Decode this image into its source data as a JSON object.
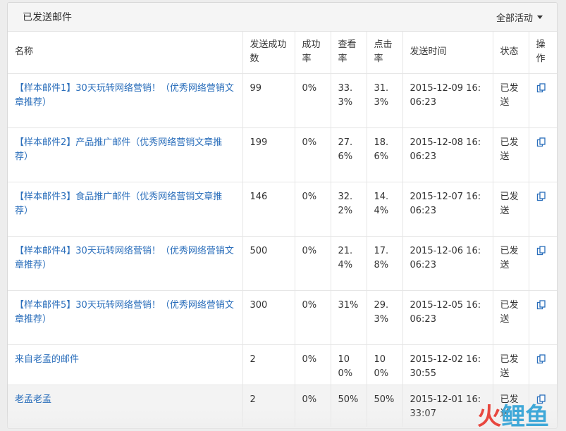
{
  "header": {
    "title": "已发送邮件",
    "activity_filter": "全部活动"
  },
  "columns": {
    "name": "名称",
    "sent": "发送成功数",
    "success_rate": "成功率",
    "view_rate": "查看率",
    "click_rate": "点击率",
    "send_time": "发送时间",
    "status": "状态",
    "action": "操作"
  },
  "rows": [
    {
      "name": "【样本邮件1】30天玩转网络营销！（优秀网络营销文章推荐）",
      "sent": "99",
      "success_rate": "0%",
      "view_rate": "33.3%",
      "click_rate": "31.3%",
      "send_time": "2015-12-09 16:06:23",
      "status": "已发送"
    },
    {
      "name": "【样本邮件2】产品推广邮件（优秀网络营销文章推荐）",
      "sent": "199",
      "success_rate": "0%",
      "view_rate": "27.6%",
      "click_rate": "18.6%",
      "send_time": "2015-12-08 16:06:23",
      "status": "已发送"
    },
    {
      "name": "【样本邮件3】食品推广邮件（优秀网络营销文章推荐）",
      "sent": "146",
      "success_rate": "0%",
      "view_rate": "32.2%",
      "click_rate": "14.4%",
      "send_time": "2015-12-07 16:06:23",
      "status": "已发送"
    },
    {
      "name": "【样本邮件4】30天玩转网络营销！（优秀网络营销文章推荐）",
      "sent": "500",
      "success_rate": "0%",
      "view_rate": "21.4%",
      "click_rate": "17.8%",
      "send_time": "2015-12-06 16:06:23",
      "status": "已发送"
    },
    {
      "name": "【样本邮件5】30天玩转网络营销！（优秀网络营销文章推荐）",
      "sent": "300",
      "success_rate": "0%",
      "view_rate": "31%",
      "click_rate": "29.3%",
      "send_time": "2015-12-05 16:06:23",
      "status": "已发送"
    },
    {
      "name": "来自老孟的邮件",
      "sent": "2",
      "success_rate": "0%",
      "view_rate": "100%",
      "click_rate": "100%",
      "send_time": "2015-12-02 16:30:55",
      "status": "已发送"
    },
    {
      "name": "老孟老孟",
      "sent": "2",
      "success_rate": "0%",
      "view_rate": "50%",
      "click_rate": "50%",
      "send_time": "2015-12-01 16:33:07",
      "status": "已发送"
    }
  ],
  "icons": {
    "copy": "copy-icon",
    "dropdown": "caret-down-icon"
  },
  "watermark": {
    "first": "火",
    "rest": "鲤鱼"
  },
  "colors": {
    "link": "#2a6ebb",
    "header_bg": "#f5f5f5",
    "watermark_red": "#e8473f",
    "watermark_blue": "#3fa8d8"
  }
}
